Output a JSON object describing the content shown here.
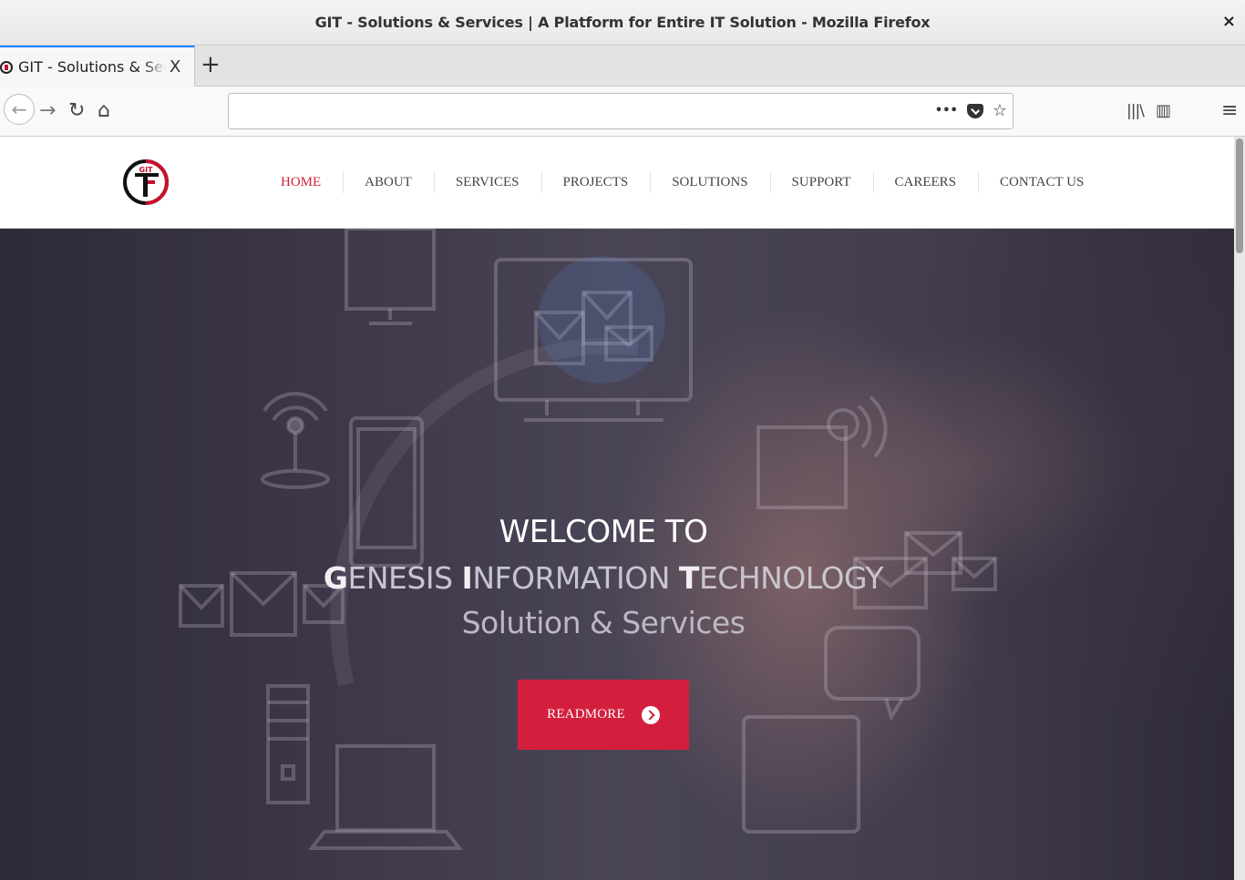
{
  "window": {
    "title": "GIT - Solutions & Services | A Platform for Entire IT Solution - Mozilla Firefox",
    "close_glyph": "×"
  },
  "tabs": [
    {
      "label": "GIT - Solutions & Services | A Platform for Entire IT Solution",
      "close_glyph": "X"
    }
  ],
  "newtab_glyph": "+",
  "toolbar": {
    "back_glyph": "←",
    "forward_glyph": "→",
    "reload_glyph": "↻",
    "home_glyph": "⌂",
    "url_value": "",
    "page_actions_glyph": "•••",
    "bookmark_glyph": "☆",
    "library_glyph": "|||\\",
    "sidebar_glyph": "▥",
    "menu_glyph": "≡"
  },
  "site": {
    "nav": [
      {
        "label": "HOME",
        "active": true
      },
      {
        "label": "ABOUT"
      },
      {
        "label": "SERVICES"
      },
      {
        "label": "PROJECTS"
      },
      {
        "label": "SOLUTIONS"
      },
      {
        "label": "SUPPORT"
      },
      {
        "label": "CAREERS"
      },
      {
        "label": "CONTACT US"
      }
    ],
    "logo_text": "GIT",
    "hero": {
      "welcome": "WELCOME TO",
      "company_words": [
        {
          "initial": "G",
          "rest": "ENESIS"
        },
        {
          "initial": "I",
          "rest": "NFORMATION"
        },
        {
          "initial": "T",
          "rest": "ECHNOLOGY"
        }
      ],
      "tagline": "Solution & Services",
      "button_label": "READMORE"
    }
  },
  "colors": {
    "accent": "#d31f3d",
    "nav_active": "#d0203b",
    "firefox_tab_highlight": "#0a84ff"
  }
}
